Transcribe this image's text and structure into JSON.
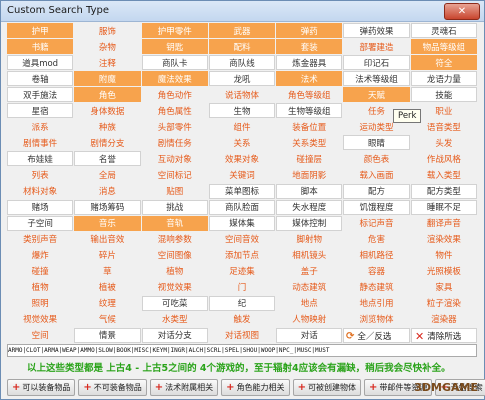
{
  "window": {
    "title": "Custom Search Type",
    "close_label": "✕"
  },
  "grid_rows": [
    [
      "护甲",
      "服饰",
      "护甲零件",
      "武器",
      "弹药",
      "弹药效果",
      "灵魂石"
    ],
    [
      "书籍",
      "杂物",
      "钥匙",
      "配料",
      "套装",
      "部署建造",
      "物品等级组"
    ],
    [
      "道具mod",
      "注释",
      "商队卡",
      "商队线",
      "炼金器具",
      "印记石",
      "符全"
    ],
    [
      "卷轴",
      "附魔",
      "魔法效果",
      "龙吼",
      "法术",
      "法术等级组",
      "龙语力量"
    ],
    [
      "双手施法",
      "角色",
      "角色动作",
      "说话物体",
      "角色等级组",
      "天赋",
      "技能"
    ],
    [
      "星宿",
      "身体数据",
      "角色属性",
      "生物",
      "生物等级组",
      "任务",
      "职业"
    ],
    [
      "派系",
      "种族",
      "头部零件",
      "组件",
      "装备位置",
      "运动类型",
      "语音类型"
    ],
    [
      "剧情事件",
      "剧情分支",
      "剧情任务",
      "关系",
      "关系类型",
      "眼睛",
      "头发"
    ],
    [
      "布娃娃",
      "名誉",
      "互动对象",
      "效果对象",
      "碰撞层",
      "颜色表",
      "作战风格"
    ],
    [
      "列表",
      "全局",
      "空间标记",
      "关键词",
      "地面阴影",
      "载入画面",
      "载入类型"
    ],
    [
      "材料对象",
      "消息",
      "贴图",
      "菜单图标",
      "脚本",
      "配方",
      "配方类型"
    ],
    [
      "赌场",
      "赌场筹码",
      "挑战",
      "商队脸面",
      "失水程度",
      "饥饿程度",
      "睡眠不足"
    ],
    [
      "子空间",
      "音乐",
      "音轨",
      "媒体集",
      "媒体控制",
      "标记声音",
      "翻译声音"
    ],
    [
      "类别声音",
      "输出音效",
      "混响参数",
      "空间音效",
      "脚射物",
      "危害",
      "渲染效果"
    ],
    [
      "爆炸",
      "碎片",
      "空间图像",
      "添加节点",
      "相机镜头",
      "相机路径",
      "物件"
    ],
    [
      "碰撞",
      "草",
      "植物",
      "足迹集",
      "盖子",
      "容器",
      "光照模板"
    ],
    [
      "植物",
      "植被",
      "视觉效果",
      "门",
      "动态建筑",
      "静态建筑",
      "家具"
    ],
    [
      "照明",
      "纹理",
      "可吃菜",
      "纪",
      "地点",
      "地点引用",
      "粒子渲染"
    ],
    [
      "视觉效果",
      "气候",
      "水类型",
      "触发",
      "人物映射",
      "浏览物体",
      "渲染器"
    ],
    [
      "空间",
      "情景",
      "对话分支",
      "对话视图",
      "对话",
      "",
      ""
    ]
  ],
  "actions": {
    "toggle_all": "全／反选",
    "clear": "清除所选"
  },
  "tooltip": {
    "text": "Perk"
  },
  "tag_bar": "ARMO|CLOT|ARMA|WEAP|AMMO|SLOW|BOOK|MISC|KEYM|INGR|ALCH|SCRL|SPEL|SHOU|WOOP|NPC_|MUSC|MUST",
  "hint": "以上这些类型都是 上古4 - 上古5之间的 4个游戏的，至于辐射4应该会有漏缺，稍后我会尽快补全。",
  "bottom_buttons": [
    "可以装备物品",
    "不可装备物品",
    "法术附属相关",
    "角色能力相关",
    "可被创建物体",
    "带邮件等资源",
    "开始搜索"
  ],
  "watermark": "3DMGAME"
}
